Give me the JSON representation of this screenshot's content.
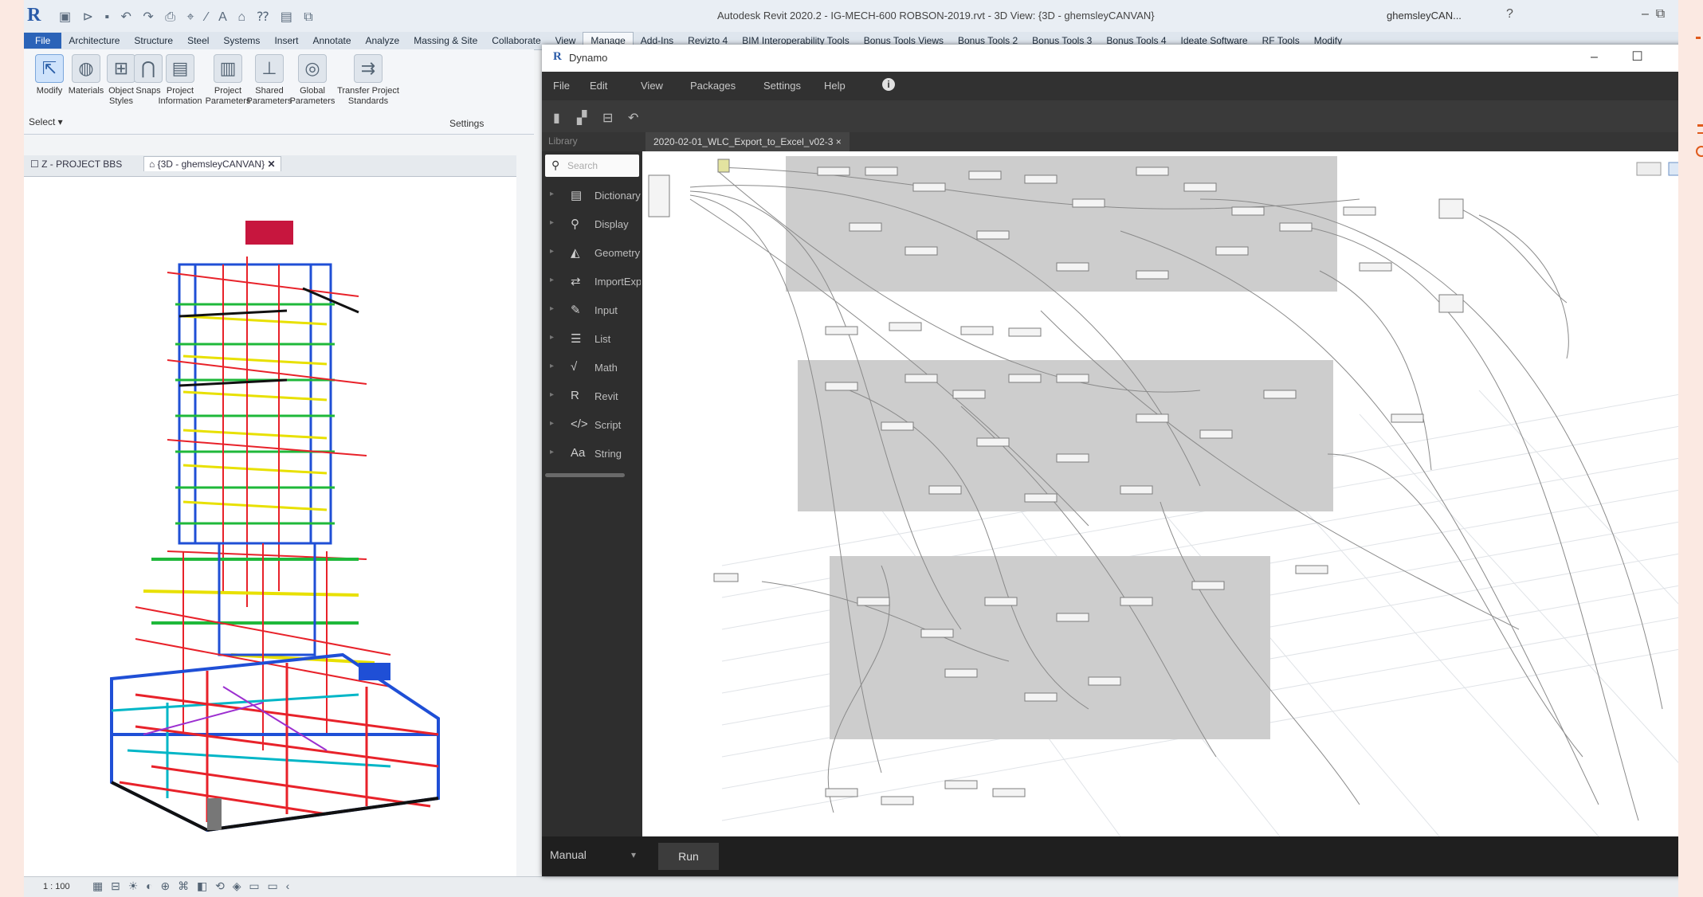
{
  "revit": {
    "window_title": "Autodesk Revit 2020.2 - IG-MECH-600 ROBSON-2019.rvt - 3D View: {3D - ghemsleyCANVAN}",
    "user": "ghemsleyCAN...",
    "help": "?",
    "ribbon_tabs": [
      "File",
      "Architecture",
      "Structure",
      "Steel",
      "Systems",
      "Insert",
      "Annotate",
      "Analyze",
      "Massing & Site",
      "Collaborate",
      "View",
      "Manage",
      "Add-Ins",
      "Revizto 4",
      "BIM Interoperability Tools",
      "Bonus Tools Views",
      "Bonus Tools 2",
      "Bonus Tools 3",
      "Bonus Tools 4",
      "Ideate Software",
      "RF Tools",
      "Modify"
    ],
    "ribbon_buttons": [
      {
        "label": "Modify",
        "icon": "cursor-icon"
      },
      {
        "label": "Materials",
        "icon": "materials-icon"
      },
      {
        "label": "Object Styles",
        "icon": "object-styles-icon"
      },
      {
        "label": "Snaps",
        "icon": "snaps-icon"
      },
      {
        "label": "Project Information",
        "icon": "project-information-icon"
      },
      {
        "label": "Project Parameters",
        "icon": "project-parameters-icon"
      },
      {
        "label": "Shared Parameters",
        "icon": "shared-parameters-icon"
      },
      {
        "label": "Global Parameters",
        "icon": "global-parameters-icon"
      },
      {
        "label": "Transfer Project Standards",
        "icon": "transfer-icon"
      }
    ],
    "select_label": "Select ▾",
    "settings_label": "Settings",
    "view_tabs": [
      "Z - PROJECT BBS",
      "{3D - ghemsleyCANVAN}"
    ],
    "scale": "1 : 100"
  },
  "dynamo": {
    "title": "Dynamo",
    "menu": [
      "File",
      "Edit",
      "View",
      "Packages",
      "Settings",
      "Help"
    ],
    "library_tab": "Library",
    "workspace_tab": "2020-02-01_WLC_Export_to_Excel_v02-3 ×",
    "search_placeholder": "Search",
    "library_items": [
      {
        "label": "Dictionary",
        "icon": "dictionary-icon"
      },
      {
        "label": "Display",
        "icon": "display-icon"
      },
      {
        "label": "Geometry",
        "icon": "geometry-icon"
      },
      {
        "label": "ImportExport",
        "icon": "import-export-icon"
      },
      {
        "label": "Input",
        "icon": "input-icon"
      },
      {
        "label": "List",
        "icon": "list-icon"
      },
      {
        "label": "Math",
        "icon": "math-icon"
      },
      {
        "label": "Revit",
        "icon": "revit-icon"
      },
      {
        "label": "Script",
        "icon": "script-icon"
      },
      {
        "label": "String",
        "icon": "string-icon"
      }
    ],
    "run_mode": "Manual",
    "run_button": "Run"
  },
  "colors": {
    "page_bg": "#fbe9e2",
    "file_tab": "#2b63b8",
    "dynamo_dark": "#2b2b2b",
    "node_group": "#cfcfcf",
    "edge_accent": "#e05a1c"
  }
}
